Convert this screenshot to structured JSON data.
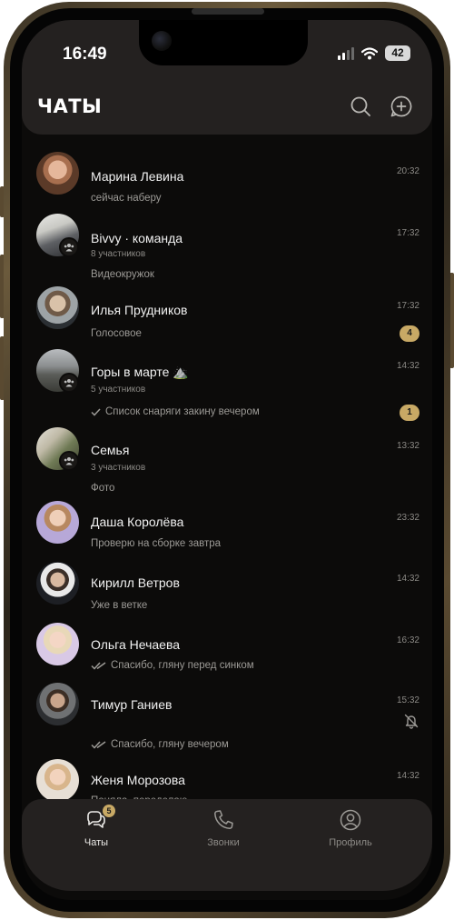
{
  "status_bar": {
    "time": "16:49",
    "battery": "42"
  },
  "header": {
    "title": "ЧАТЫ"
  },
  "chats": [
    {
      "name": "Марина Левина",
      "preview": "сейчас наберу",
      "time": "20:32"
    },
    {
      "name": "Bivvy · команда",
      "members": "8 участников",
      "preview": "Видеокружок",
      "time": "17:32"
    },
    {
      "name": "Илья Прудников",
      "preview": "Голосовое",
      "time": "17:32",
      "unread": "4"
    },
    {
      "name": "Горы в марте ⛰️",
      "members": "5 участников",
      "preview": "Список снаряги закину вечером",
      "time": "14:32",
      "unread": "1"
    },
    {
      "name": "Семья",
      "members": "3 участников",
      "preview": "Фото",
      "time": "13:32"
    },
    {
      "name": "Даша Королёва",
      "preview": "Проверю на сборке завтра",
      "time": "23:32"
    },
    {
      "name": "Кирилл Ветров",
      "preview": "Уже в ветке",
      "time": "14:32"
    },
    {
      "name": "Ольга Нечаева",
      "preview": "Спасибо, гляну перед синком",
      "time": "16:32"
    },
    {
      "name": "Тимур Ганиев",
      "preview": "Спасибо, гляну вечером",
      "time": "15:32"
    },
    {
      "name": "Женя Морозова",
      "preview": "Поняла, переделаю",
      "time": "14:32"
    }
  ],
  "tabbar": {
    "chats": {
      "label": "Чаты",
      "badge": "5"
    },
    "calls": {
      "label": "Звонки"
    },
    "profile": {
      "label": "Профиль"
    }
  },
  "colors": {
    "accent": "#c8a965",
    "background": "#0c0b0a",
    "surface": "#242120"
  }
}
